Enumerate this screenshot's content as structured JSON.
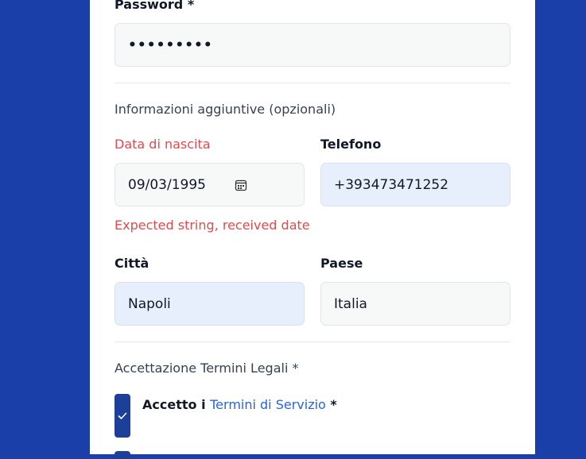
{
  "form": {
    "password_label": "Password *",
    "password_value": "•••••••••",
    "additional_section_title": "Informazioni aggiuntive (opzionali)",
    "birthdate_label": "Data di nascita",
    "birthdate_value": "09/03/1995",
    "birthdate_error": "Expected string, received date",
    "phone_label": "Telefono",
    "phone_value": "+393473471252",
    "city_label": "Città",
    "city_value": "Napoli",
    "country_label": "Paese",
    "country_value": "Italia",
    "legal_section_title": "Accettazione Termini Legali *",
    "terms_prefix": "Accetto i",
    "terms_link": "Termini di Servizio",
    "terms_suffix": "*"
  },
  "colors": {
    "background": "#1a3fa8",
    "error": "#e5484d",
    "link": "#2563eb",
    "checkbox": "#1c3f99"
  }
}
